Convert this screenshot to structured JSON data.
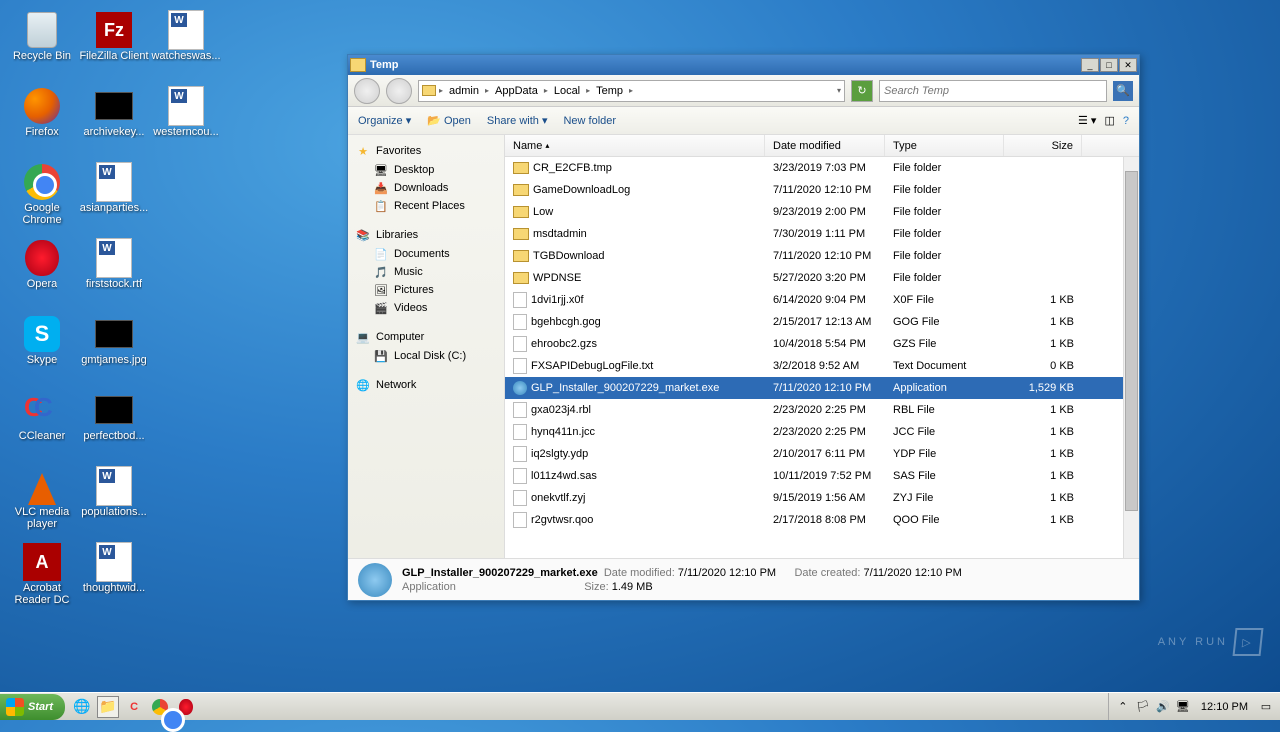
{
  "desktop": {
    "icons": [
      {
        "label": "Recycle Bin",
        "kind": "bin"
      },
      {
        "label": "Firefox",
        "kind": "firefox"
      },
      {
        "label": "Google Chrome",
        "kind": "chrome"
      },
      {
        "label": "Opera",
        "kind": "opera"
      },
      {
        "label": "Skype",
        "kind": "skype"
      },
      {
        "label": "CCleaner",
        "kind": "ccleaner"
      },
      {
        "label": "VLC media player",
        "kind": "vlc"
      },
      {
        "label": "Acrobat Reader DC",
        "kind": "adobe"
      },
      {
        "label": "FileZilla Client",
        "kind": "filezilla"
      },
      {
        "label": "archivekey...",
        "kind": "thumb"
      },
      {
        "label": "asianparties...",
        "kind": "word"
      },
      {
        "label": "firststock.rtf",
        "kind": "word"
      },
      {
        "label": "gmtjames.jpg",
        "kind": "thumb"
      },
      {
        "label": "perfectbod...",
        "kind": "thumb"
      },
      {
        "label": "populations...",
        "kind": "word"
      },
      {
        "label": "thoughtwid...",
        "kind": "word"
      },
      {
        "label": "watcheswas...",
        "kind": "word"
      },
      {
        "label": "westerncou...",
        "kind": "word"
      }
    ]
  },
  "window": {
    "title": "Temp",
    "breadcrumb": [
      "admin",
      "AppData",
      "Local",
      "Temp"
    ],
    "search_placeholder": "Search Temp",
    "toolbar": {
      "organize": "Organize",
      "open": "Open",
      "share": "Share with",
      "newfolder": "New folder"
    },
    "columns": {
      "name": "Name",
      "date": "Date modified",
      "type": "Type",
      "size": "Size"
    },
    "nav": {
      "favorites": "Favorites",
      "fav_items": [
        "Desktop",
        "Downloads",
        "Recent Places"
      ],
      "libraries": "Libraries",
      "lib_items": [
        "Documents",
        "Music",
        "Pictures",
        "Videos"
      ],
      "computer": "Computer",
      "comp_items": [
        "Local Disk (C:)"
      ],
      "network": "Network"
    },
    "files": [
      {
        "name": "CR_E2CFB.tmp",
        "date": "3/23/2019 7:03 PM",
        "type": "File folder",
        "size": "",
        "icon": "folder"
      },
      {
        "name": "GameDownloadLog",
        "date": "7/11/2020 12:10 PM",
        "type": "File folder",
        "size": "",
        "icon": "folder"
      },
      {
        "name": "Low",
        "date": "9/23/2019 2:00 PM",
        "type": "File folder",
        "size": "",
        "icon": "folder"
      },
      {
        "name": "msdtadmin",
        "date": "7/30/2019 1:11 PM",
        "type": "File folder",
        "size": "",
        "icon": "folder"
      },
      {
        "name": "TGBDownload",
        "date": "7/11/2020 12:10 PM",
        "type": "File folder",
        "size": "",
        "icon": "folder"
      },
      {
        "name": "WPDNSE",
        "date": "5/27/2020 3:20 PM",
        "type": "File folder",
        "size": "",
        "icon": "folder"
      },
      {
        "name": "1dvi1rjj.x0f",
        "date": "6/14/2020 9:04 PM",
        "type": "X0F File",
        "size": "1 KB",
        "icon": "file"
      },
      {
        "name": "bgehbcgh.gog",
        "date": "2/15/2017 12:13 AM",
        "type": "GOG File",
        "size": "1 KB",
        "icon": "file"
      },
      {
        "name": "ehroobc2.gzs",
        "date": "10/4/2018 5:54 PM",
        "type": "GZS File",
        "size": "1 KB",
        "icon": "file"
      },
      {
        "name": "FXSAPIDebugLogFile.txt",
        "date": "3/2/2018 9:52 AM",
        "type": "Text Document",
        "size": "0 KB",
        "icon": "file"
      },
      {
        "name": "GLP_Installer_900207229_market.exe",
        "date": "7/11/2020 12:10 PM",
        "type": "Application",
        "size": "1,529 KB",
        "icon": "app",
        "selected": true
      },
      {
        "name": "gxa023j4.rbl",
        "date": "2/23/2020 2:25 PM",
        "type": "RBL File",
        "size": "1 KB",
        "icon": "file"
      },
      {
        "name": "hynq411n.jcc",
        "date": "2/23/2020 2:25 PM",
        "type": "JCC File",
        "size": "1 KB",
        "icon": "file"
      },
      {
        "name": "iq2slgty.ydp",
        "date": "2/10/2017 6:11 PM",
        "type": "YDP File",
        "size": "1 KB",
        "icon": "file"
      },
      {
        "name": "l011z4wd.sas",
        "date": "10/11/2019 7:52 PM",
        "type": "SAS File",
        "size": "1 KB",
        "icon": "file"
      },
      {
        "name": "onekvtlf.zyj",
        "date": "9/15/2019 1:56 AM",
        "type": "ZYJ File",
        "size": "1 KB",
        "icon": "file"
      },
      {
        "name": "r2gvtwsr.qoo",
        "date": "2/17/2018 8:08 PM",
        "type": "QOO File",
        "size": "1 KB",
        "icon": "file"
      }
    ],
    "details": {
      "name": "GLP_Installer_900207229_market.exe",
      "type": "Application",
      "modified_label": "Date modified:",
      "modified": "7/11/2020 12:10 PM",
      "created_label": "Date created:",
      "created": "7/11/2020 12:10 PM",
      "size_label": "Size:",
      "size": "1.49 MB"
    }
  },
  "taskbar": {
    "start": "Start",
    "time": "12:10 PM"
  },
  "watermark": "ANY RUN"
}
